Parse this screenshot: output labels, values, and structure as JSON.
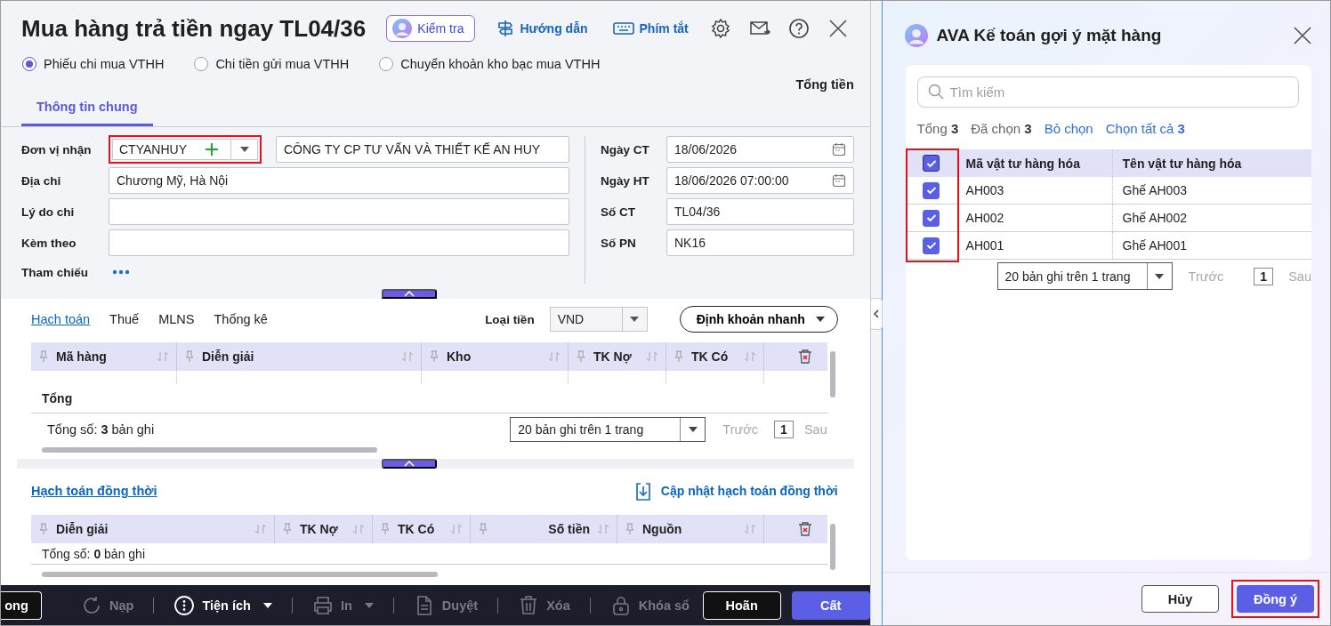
{
  "header": {
    "title": "Mua hàng trả tiền ngay TL04/36",
    "check_button": "Kiểm tra",
    "guide_link": "Hướng dẫn",
    "shortcuts_link": "Phím tắt"
  },
  "voucher_types": [
    {
      "label": "Phiếu chi mua VTHH",
      "selected": true
    },
    {
      "label": "Chi tiền gửi mua VTHH",
      "selected": false
    },
    {
      "label": "Chuyển khoản kho bạc mua VTHH",
      "selected": false
    }
  ],
  "total_label": "Tổng tiền",
  "tabs": [
    {
      "label": "Thông tin chung",
      "selected": true
    }
  ],
  "form_left": [
    {
      "label": "Đơn vị nhận",
      "kind": "combo",
      "value": "CTYANHUY",
      "extra": "CÔNG TY CP TƯ VẤN VÀ THIẾT KẾ AN HUY",
      "highlighted": true
    },
    {
      "label": "Địa chỉ",
      "kind": "text",
      "value": "Chương Mỹ, Hà Nội"
    },
    {
      "label": "Lý do chi",
      "kind": "text"
    },
    {
      "label": "Kèm theo",
      "kind": "text"
    },
    {
      "label": "Tham chiếu",
      "kind": "more"
    }
  ],
  "form_right": [
    {
      "label": "Ngày CT",
      "kind": "date",
      "value": "18/06/2026"
    },
    {
      "label": "Ngày HT",
      "kind": "date",
      "value": "18/06/2026 07:00:00"
    },
    {
      "label": "Số CT",
      "kind": "text",
      "value": "TL04/36"
    },
    {
      "label": "Số PN",
      "kind": "text",
      "value": "NK16"
    }
  ],
  "detail": {
    "tabs": [
      {
        "label": "Hạch toán",
        "selected": true
      },
      {
        "label": "Thuế",
        "selected": false
      },
      {
        "label": "MLNS",
        "selected": false
      },
      {
        "label": "Thống kê",
        "selected": false
      }
    ],
    "currency_label": "Loại tiền",
    "currency": "VND",
    "quick_button": "Định khoản nhanh",
    "columns": [
      {
        "label": "Mã hàng",
        "numeric": false
      },
      {
        "label": "Diễn giải",
        "numeric": false
      },
      {
        "label": "Kho",
        "numeric": false
      },
      {
        "label": "TK Nợ",
        "numeric": false
      },
      {
        "label": "TK Có",
        "numeric": false
      }
    ],
    "total_row": "Tổng",
    "count": "Tổng số: **3** bản ghi",
    "page_size": "20 bản ghi trên 1 trang",
    "prev": "Trước",
    "page": "1",
    "next": "Sau"
  },
  "concurrent": {
    "title": "Hạch toán đồng thời",
    "update_button": "Cập nhật hạch toán đồng thời",
    "columns": [
      {
        "label": "Diễn giải",
        "numeric": false
      },
      {
        "label": "TK Nợ",
        "numeric": false
      },
      {
        "label": "TK Có",
        "numeric": false
      },
      {
        "label": "Số tiền",
        "numeric": true
      },
      {
        "label": "Nguồn",
        "numeric": false
      }
    ],
    "count": "Tổng số: **0** bản ghi"
  },
  "toolbar": [
    {
      "label": "ong",
      "kind": "outline"
    },
    {
      "label": "Nạp",
      "kind": "tool",
      "disabled": true,
      "has_menu": false
    },
    {
      "label": "Tiện ích",
      "kind": "tool",
      "disabled": false,
      "has_menu": true
    },
    {
      "label": "In",
      "kind": "tool",
      "disabled": true,
      "has_menu": true
    },
    {
      "label": "Duyệt",
      "kind": "tool",
      "disabled": true,
      "has_menu": false
    },
    {
      "label": "Xóa",
      "kind": "tool",
      "disabled": true,
      "has_menu": false
    },
    {
      "label": "Khóa sổ",
      "kind": "tool",
      "disabled": true,
      "has_menu": false
    },
    {
      "label": "Hoãn",
      "kind": "outline"
    },
    {
      "label": "Cất",
      "kind": "primary"
    }
  ],
  "suggest_panel": {
    "title": "AVA Kế toán gợi ý mặt hàng",
    "search_placeholder": "Tìm kiếm",
    "summary": [
      {
        "text": "Tổng **3**",
        "kind": "info"
      },
      {
        "text": "Đã chọn **3**",
        "kind": "info"
      },
      {
        "text": "Bỏ chọn",
        "kind": "link"
      },
      {
        "text": "Chọn tất cả **3**",
        "kind": "link"
      }
    ],
    "columns": [
      "Mã vật tư hàng hóa",
      "Tên vật tư hàng hóa"
    ],
    "all_checked": true,
    "checkbox_column_highlighted": true,
    "rows": [
      {
        "code": "AH003",
        "name": "Ghế AH003",
        "checked": true
      },
      {
        "code": "AH002",
        "name": "Ghế AH002",
        "checked": true
      },
      {
        "code": "AH001",
        "name": "Ghế AH001",
        "checked": true
      }
    ],
    "page_size": "20 bản ghi trên 1 trang",
    "prev": "Trước",
    "page": "1",
    "next": "Sau",
    "buttons": [
      {
        "label": "Hủy",
        "kind": "secondary",
        "highlighted": false
      },
      {
        "label": "Đồng ý",
        "kind": "primary",
        "highlighted": true
      }
    ]
  }
}
